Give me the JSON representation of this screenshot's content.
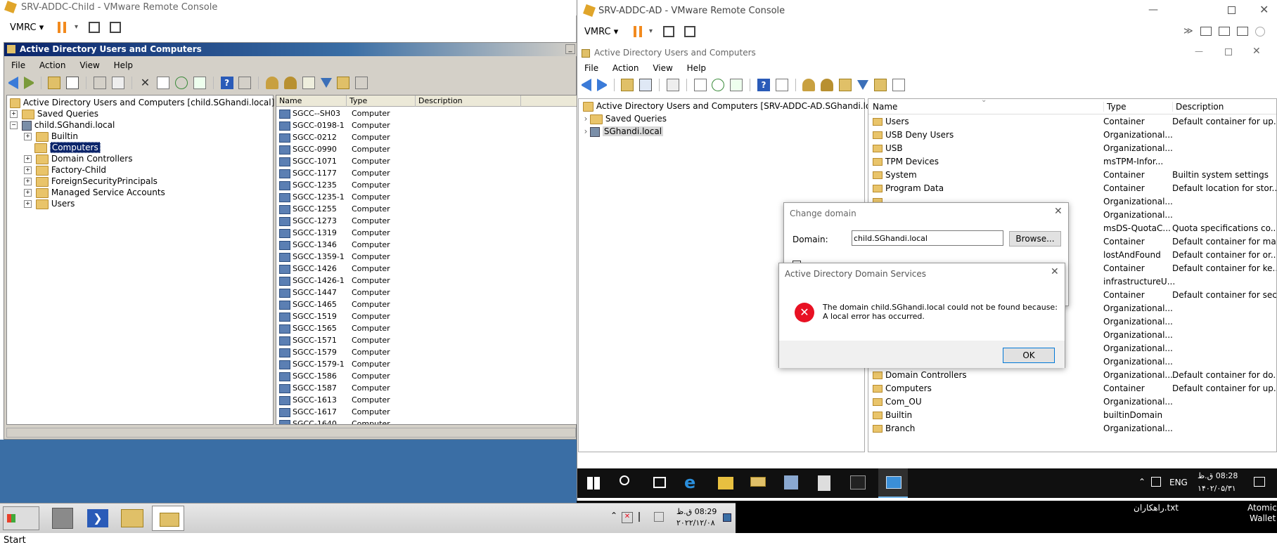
{
  "left_window": {
    "title": "SRV-ADDC-Child - VMware Remote Console",
    "vmrc_label": "VMRC",
    "inner_title": "Active Directory Users and Computers",
    "menu": [
      "File",
      "Action",
      "View",
      "Help"
    ],
    "tree": {
      "root": "Active Directory Users and Computers [child.SGhandi.local]",
      "saved_queries": "Saved Queries",
      "domain": "child.SGhandi.local",
      "children": [
        "Builtin",
        "Computers",
        "Domain Controllers",
        "Factory-Child",
        "ForeignSecurityPrincipals",
        "Managed Service Accounts",
        "Users"
      ]
    },
    "columns": [
      "Name",
      "Type",
      "Description"
    ],
    "rows": [
      {
        "name": "SGCC--SH03",
        "type": "Computer"
      },
      {
        "name": "SGCC-0198-1",
        "type": "Computer"
      },
      {
        "name": "SGCC-0212",
        "type": "Computer"
      },
      {
        "name": "SGCC-0990",
        "type": "Computer"
      },
      {
        "name": "SGCC-1071",
        "type": "Computer"
      },
      {
        "name": "SGCC-1177",
        "type": "Computer"
      },
      {
        "name": "SGCC-1235",
        "type": "Computer"
      },
      {
        "name": "SGCC-1235-1",
        "type": "Computer"
      },
      {
        "name": "SGCC-1255",
        "type": "Computer"
      },
      {
        "name": "SGCC-1273",
        "type": "Computer"
      },
      {
        "name": "SGCC-1319",
        "type": "Computer"
      },
      {
        "name": "SGCC-1346",
        "type": "Computer"
      },
      {
        "name": "SGCC-1359-1",
        "type": "Computer"
      },
      {
        "name": "SGCC-1426",
        "type": "Computer"
      },
      {
        "name": "SGCC-1426-1",
        "type": "Computer"
      },
      {
        "name": "SGCC-1447",
        "type": "Computer"
      },
      {
        "name": "SGCC-1465",
        "type": "Computer"
      },
      {
        "name": "SGCC-1519",
        "type": "Computer"
      },
      {
        "name": "SGCC-1565",
        "type": "Computer"
      },
      {
        "name": "SGCC-1571",
        "type": "Computer"
      },
      {
        "name": "SGCC-1579",
        "type": "Computer"
      },
      {
        "name": "SGCC-1579-1",
        "type": "Computer"
      },
      {
        "name": "SGCC-1586",
        "type": "Computer"
      },
      {
        "name": "SGCC-1587",
        "type": "Computer"
      },
      {
        "name": "SGCC-1613",
        "type": "Computer"
      },
      {
        "name": "SGCC-1617",
        "type": "Computer"
      },
      {
        "name": "SGCC-1640",
        "type": "Computer"
      }
    ],
    "taskbar": {
      "start_label": "Start",
      "time": "08:29 ق.ظ",
      "date": "۲۰۲۲/۱۲/۰۸"
    }
  },
  "right_window": {
    "title": "SRV-ADDC-AD - VMware Remote Console",
    "vmrc_label": "VMRC",
    "inner_title": "Active Directory Users and Computers",
    "menu": [
      "File",
      "Action",
      "View",
      "Help"
    ],
    "tree": {
      "root": "Active Directory Users and Computers [SRV-ADDC-AD.SGhandi.local]",
      "saved_queries": "Saved Queries",
      "domain": "SGhandi.local"
    },
    "columns": [
      "Name",
      "Type",
      "Description"
    ],
    "rows": [
      {
        "name": "Users",
        "type": "Container",
        "desc": "Default container for up..."
      },
      {
        "name": "USB Deny Users",
        "type": "Organizational...",
        "desc": ""
      },
      {
        "name": "USB",
        "type": "Organizational...",
        "desc": ""
      },
      {
        "name": "TPM Devices",
        "type": "msTPM-Infor...",
        "desc": ""
      },
      {
        "name": "System",
        "type": "Container",
        "desc": "Builtin system settings"
      },
      {
        "name": "Program Data",
        "type": "Container",
        "desc": "Default location for stor..."
      },
      {
        "name": "",
        "type": "Organizational...",
        "desc": ""
      },
      {
        "name": "",
        "type": "Organizational...",
        "desc": ""
      },
      {
        "name": "",
        "type": "msDS-QuotaC...",
        "desc": "Quota specifications co..."
      },
      {
        "name": "",
        "type": "Container",
        "desc": "Default container for ma..."
      },
      {
        "name": "",
        "type": "lostAndFound",
        "desc": "Default container for or..."
      },
      {
        "name": "",
        "type": "Container",
        "desc": "Default container for ke..."
      },
      {
        "name": "",
        "type": "infrastructureU...",
        "desc": ""
      },
      {
        "name": "",
        "type": "Container",
        "desc": "Default container for sec..."
      },
      {
        "name": "",
        "type": "Organizational...",
        "desc": ""
      },
      {
        "name": "",
        "type": "Organizational...",
        "desc": ""
      },
      {
        "name": "",
        "type": "Organizational...",
        "desc": ""
      },
      {
        "name": "",
        "type": "Organizational...",
        "desc": ""
      },
      {
        "name": "",
        "type": "Organizational...",
        "desc": ""
      },
      {
        "name": "Domain Controllers",
        "type": "Organizational...",
        "desc": "Default container for do..."
      },
      {
        "name": "Computers",
        "type": "Container",
        "desc": "Default container for up..."
      },
      {
        "name": "Com_OU",
        "type": "Organizational...",
        "desc": ""
      },
      {
        "name": "Builtin",
        "type": "builtinDomain",
        "desc": ""
      },
      {
        "name": "Branch",
        "type": "Organizational...",
        "desc": ""
      }
    ],
    "taskbar": {
      "lang": "ENG",
      "time": "08:28 ق.ظ",
      "date": "۱۴۰۲/۰۵/۳۱"
    }
  },
  "change_domain_dialog": {
    "title": "Change domain",
    "domain_label": "Domain:",
    "domain_value": "child.SGhandi.local",
    "browse_label": "Browse..."
  },
  "error_dialog": {
    "title": "Active Directory Domain Services",
    "message_line1": "The domain child.SGhandi.local could not be found because:",
    "message_line2": "A local error has occurred.",
    "ok_label": "OK"
  },
  "desktop": {
    "file_label": "راهکاران.txt",
    "app_label_1": "Atomic",
    "app_label_2": "Wallet"
  },
  "colors": {
    "desktop_blue": "#3a6ea5",
    "dark_taskbar": "#101010",
    "selection": "#0a246a",
    "error_red": "#e81123"
  }
}
